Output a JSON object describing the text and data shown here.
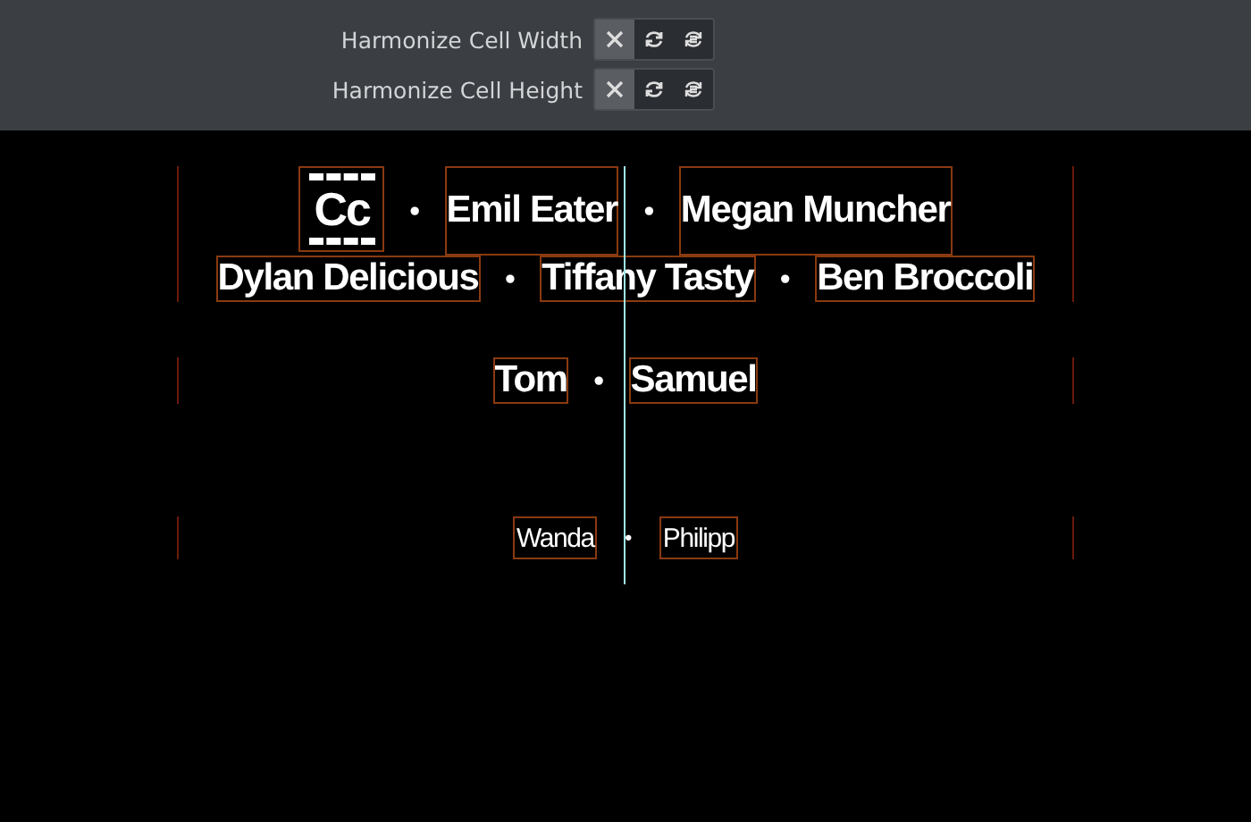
{
  "toolbar": [
    {
      "label": "Harmonize Cell Width",
      "buttons": [
        {
          "kind": "clear",
          "selected": true
        },
        {
          "kind": "cycle",
          "selected": false
        },
        {
          "kind": "cycle-all",
          "selected": false
        }
      ]
    },
    {
      "label": "Harmonize Cell Height",
      "buttons": [
        {
          "kind": "clear",
          "selected": true
        },
        {
          "kind": "cycle",
          "selected": false
        },
        {
          "kind": "cycle-all",
          "selected": false
        }
      ]
    }
  ],
  "sections": [
    {
      "kind": "large",
      "separator": "•",
      "lines": [
        [
          {
            "kind": "logo",
            "text": "Cc"
          },
          {
            "kind": "name",
            "text": "Emil Eater"
          },
          {
            "kind": "name",
            "text": "Megan Muncher"
          }
        ],
        [
          {
            "kind": "name",
            "text": "Dylan Delicious"
          },
          {
            "kind": "name",
            "text": "Tiffany Tasty"
          },
          {
            "kind": "name",
            "text": "Ben Broccoli"
          }
        ]
      ]
    },
    {
      "kind": "large",
      "separator": "•",
      "lines": [
        [
          {
            "kind": "name",
            "text": "Tom"
          },
          {
            "kind": "name",
            "text": "Samuel"
          }
        ]
      ]
    },
    {
      "kind": "small",
      "separator": "•",
      "lines": [
        [
          {
            "kind": "name",
            "text": "Wanda"
          },
          {
            "kind": "name",
            "text": "Philipp"
          }
        ]
      ]
    }
  ]
}
